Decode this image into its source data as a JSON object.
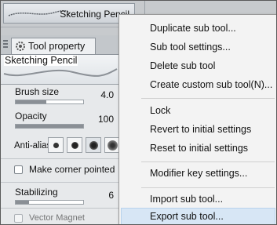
{
  "top_strip": {
    "brush_name": "Sketching Pencil"
  },
  "panel": {
    "tab_label": "Tool property",
    "preview_name": "Sketching Pencil",
    "brush_size": {
      "label": "Brush size",
      "value": "4.0",
      "level": 0.45
    },
    "opacity": {
      "label": "Opacity",
      "value": "100",
      "level": 1.0
    },
    "anti_alias": {
      "label": "Anti-alias"
    },
    "make_corner": {
      "label": "Make corner pointed"
    },
    "stabilizing": {
      "label": "Stabilizing",
      "value": "6",
      "level": 0.2
    },
    "vector_magnet": {
      "label": "Vector Magnet"
    }
  },
  "menu": {
    "items": [
      "Duplicate sub tool...",
      "Sub tool settings...",
      "Delete sub tool",
      "Create custom sub tool(N)...",
      "Lock",
      "Revert to initial settings",
      "Reset to initial settings",
      "Modifier key settings...",
      "Import sub tool...",
      "Export sub tool..."
    ],
    "highlighted": "Export sub tool..."
  },
  "colors": {
    "menu_background": "#f3f3f3",
    "menu_highlight": "#d7e6f5",
    "panel_background": "#e7e9eb"
  }
}
